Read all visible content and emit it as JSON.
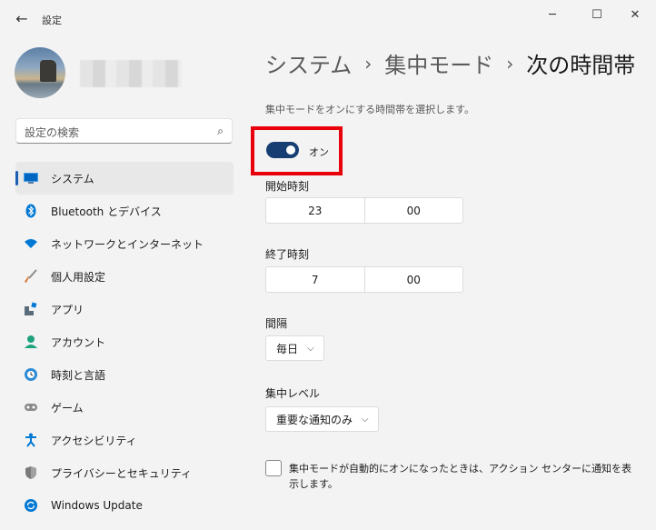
{
  "window": {
    "title": "設定",
    "back_icon": "←",
    "minimize_icon": "─",
    "maximize_icon": "☐",
    "close_icon": "✕"
  },
  "search": {
    "placeholder": "設定の検索",
    "icon": "⌕"
  },
  "sidebar": {
    "items": [
      {
        "label": "システム",
        "icon": "system-icon",
        "color": "#0067c0",
        "selected": true
      },
      {
        "label": "Bluetooth とデバイス",
        "icon": "bluetooth-icon",
        "color": "#0078d4"
      },
      {
        "label": "ネットワークとインターネット",
        "icon": "wifi-icon",
        "color": "#0078d4"
      },
      {
        "label": "個人用設定",
        "icon": "brush-icon",
        "color": "#d8742b"
      },
      {
        "label": "アプリ",
        "icon": "apps-icon",
        "color": "#5a6b7a"
      },
      {
        "label": "アカウント",
        "icon": "account-icon",
        "color": "#1fa27e"
      },
      {
        "label": "時刻と言語",
        "icon": "clock-globe-icon",
        "color": "#0078d4"
      },
      {
        "label": "ゲーム",
        "icon": "gamepad-icon",
        "color": "#6f6f6f"
      },
      {
        "label": "アクセシビリティ",
        "icon": "accessibility-icon",
        "color": "#0078d4"
      },
      {
        "label": "プライバシーとセキュリティ",
        "icon": "shield-icon",
        "color": "#6f6f6f"
      },
      {
        "label": "Windows Update",
        "icon": "update-icon",
        "color": "#0078d4"
      }
    ]
  },
  "breadcrumb": {
    "items": [
      "システム",
      "集中モード",
      "次の時間帯"
    ],
    "separator": "›"
  },
  "main": {
    "description": "集中モードをオンにする時間帯を選択します。",
    "toggle": {
      "label": "オン",
      "state": true
    },
    "start": {
      "label": "開始時刻",
      "hour": "23",
      "minute": "00"
    },
    "end": {
      "label": "終了時刻",
      "hour": "7",
      "minute": "00"
    },
    "interval": {
      "label": "間隔",
      "value": "毎日"
    },
    "level": {
      "label": "集中レベル",
      "value": "重要な通知のみ"
    },
    "checkbox": {
      "label": "集中モードが自動的にオンになったときは、アクション センターに通知を表示します。",
      "checked": false
    },
    "dropdown_chevron": "⌵"
  },
  "colors": {
    "accent": "#163e73",
    "highlight": "#e8000b"
  }
}
